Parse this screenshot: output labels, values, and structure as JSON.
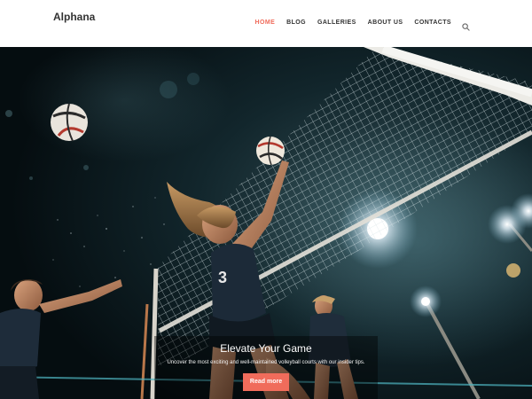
{
  "site": {
    "logo_text": "Alphana"
  },
  "nav": {
    "items": [
      {
        "label": "HOME",
        "active": true
      },
      {
        "label": "BLOG",
        "active": false
      },
      {
        "label": "GALLERIES",
        "active": false
      },
      {
        "label": "ABOUT US",
        "active": false
      },
      {
        "label": "CONTACTS",
        "active": false
      }
    ],
    "search_icon": "search-icon"
  },
  "hero": {
    "title": "Elevate Your Game",
    "subtitle": "Uncover the most exciting and well-maintained volleyball courts with our insider tips.",
    "button_label": "Read more",
    "image_alt": "volleyball-night-scene"
  },
  "colors": {
    "accent": "#f06c5b",
    "nav_text": "#333333",
    "header_bg": "#ffffff"
  }
}
